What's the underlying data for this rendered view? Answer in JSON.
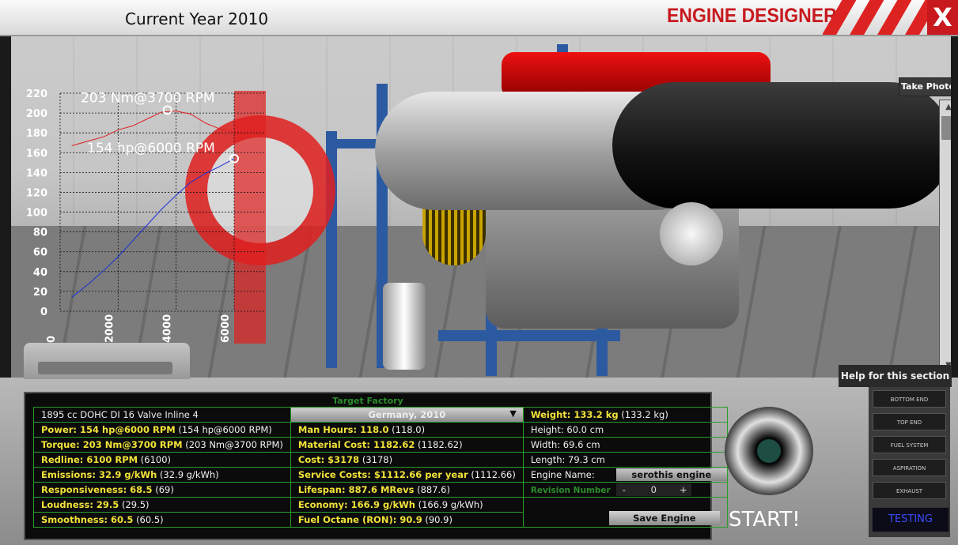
{
  "header": {
    "year_label": "Current Year 2010",
    "app_title": "ENGINE DESIGNER",
    "close_label": "X"
  },
  "viewport": {
    "take_photo_label": "Take Photo"
  },
  "chart_data": {
    "type": "line",
    "x_ticks": [
      "0",
      "2000",
      "4000",
      "6000"
    ],
    "y_ticks": [
      "0",
      "20",
      "40",
      "60",
      "80",
      "100",
      "120",
      "140",
      "160",
      "180",
      "200",
      "220"
    ],
    "ylim": [
      0,
      220
    ],
    "xlim": [
      0,
      6000
    ],
    "series": [
      {
        "color": "#e02020",
        "values": [
          [
            400,
            167
          ],
          [
            1000,
            172
          ],
          [
            1500,
            176
          ],
          [
            2000,
            183
          ],
          [
            2500,
            187
          ],
          [
            3000,
            194
          ],
          [
            3500,
            201
          ],
          [
            4000,
            202
          ],
          [
            4500,
            199
          ],
          [
            5000,
            190
          ],
          [
            5500,
            184
          ],
          [
            6000,
            181
          ]
        ]
      },
      {
        "color": "#1a2fd8",
        "values": [
          [
            400,
            14
          ],
          [
            1000,
            28
          ],
          [
            1500,
            41
          ],
          [
            2000,
            55
          ],
          [
            2500,
            71
          ],
          [
            3000,
            87
          ],
          [
            3500,
            103
          ],
          [
            4000,
            117
          ],
          [
            4500,
            130
          ],
          [
            5000,
            139
          ],
          [
            5500,
            146
          ],
          [
            6000,
            154
          ]
        ]
      }
    ],
    "annotations": [
      {
        "text": "203 Nm@3700 RPM",
        "x": 3700,
        "y": 203
      },
      {
        "text": "154 hp@6000 RPM",
        "x": 6000,
        "y": 154
      }
    ]
  },
  "stats": {
    "target_factory_label": "Target Factory",
    "engine_desc": "1895 cc DOHC DI 16 Valve Inline 4",
    "factory_value": "Germany, 2010",
    "col1": [
      {
        "label": "Power: 154 hp@6000 RPM",
        "extra": "(154 hp@6000 RPM)"
      },
      {
        "label": "Torque: 203 Nm@3700 RPM",
        "extra": "(203 Nm@3700 RPM)"
      },
      {
        "label": "Redline: 6100 RPM",
        "extra": "(6100)"
      },
      {
        "label": "Emissions: 32.9 g/kWh",
        "extra": "(32.9 g/kWh)"
      },
      {
        "label": "Responsiveness: 68.5",
        "extra": "(69)"
      },
      {
        "label": "Loudness: 29.5",
        "extra": "(29.5)"
      },
      {
        "label": "Smoothness: 60.5",
        "extra": "(60.5)"
      }
    ],
    "col2": [
      {
        "label": "Man Hours: 118.0",
        "extra": "(118.0)"
      },
      {
        "label": "Material Cost: 1182.62",
        "extra": "(1182.62)"
      },
      {
        "label": "Cost: $3178",
        "extra": "(3178)"
      },
      {
        "label": "Service Costs: $1112.66 per year",
        "extra": "(1112.66)"
      },
      {
        "label": "Lifespan: 887.6 MRevs",
        "extra": "(887.6)"
      },
      {
        "label": "Economy: 166.9 g/kWh",
        "extra": "(166.9 g/kWh)"
      },
      {
        "label": "Fuel Octane (RON): 90.9",
        "extra": "(90.9)"
      }
    ],
    "weight": {
      "label": "Weight: 133.2 kg",
      "extra": "(133.2 kg)"
    },
    "height": "Height: 60.0 cm",
    "width": "Width: 69.6 cm",
    "length": "Length: 79.3 cm",
    "engine_name_label": "Engine Name:",
    "engine_name_value": "serothis engine",
    "revision_label": "Revision Number",
    "revision_minus": "-",
    "revision_value": "0",
    "revision_plus": "+",
    "save_label": "Save Engine"
  },
  "controls": {
    "help_label": "Help for this section",
    "start_label": "START!",
    "sections": [
      "BOTTOM END",
      "TOP END",
      "FUEL SYSTEM",
      "ASPIRATION",
      "EXHAUST"
    ],
    "testing_label": "TESTING"
  }
}
